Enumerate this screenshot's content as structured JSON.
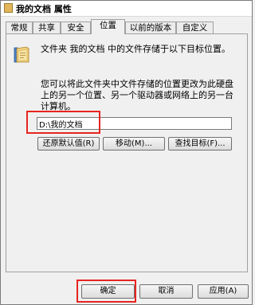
{
  "window": {
    "title": "我的文档 属性"
  },
  "tabs": [
    {
      "label": "常规",
      "active": false
    },
    {
      "label": "共享",
      "active": false
    },
    {
      "label": "安全",
      "active": false
    },
    {
      "label": "位置",
      "active": true
    },
    {
      "label": "以前的版本",
      "active": false
    },
    {
      "label": "自定义",
      "active": false
    }
  ],
  "location": {
    "description": "文件夹 我的文档 中的文件存储于以下目标位置。",
    "instructions": "您可以将此文件夹中文件存储的位置更改为此硬盘上的另一个位置、另一个驱动器或网络上的另一台计算机。",
    "path": "D:\\我的文档",
    "restore_default_label": "还原默认值(R)",
    "move_label": "移动(M)...",
    "find_target_label": "查找目标(F)..."
  },
  "footer": {
    "ok_label": "确定",
    "cancel_label": "取消",
    "apply_label": "应用(A)"
  },
  "colors": {
    "highlight": "#e8241f",
    "background": "#f0f0f0"
  },
  "icons": {
    "title": "folder-icon",
    "location": "folder-icon"
  }
}
